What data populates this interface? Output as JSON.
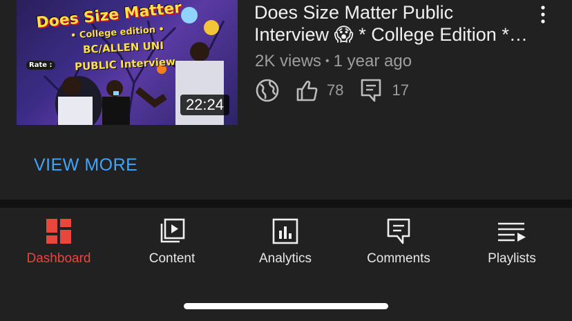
{
  "video": {
    "thumbnail_text": {
      "headline": "Does Size Matter",
      "subline": "• College edition •",
      "school": "BC/ALLEN UNI",
      "interview": "PUBLIC Interview",
      "rate": "Rate :"
    },
    "duration": "22:24",
    "title": "Does Size Matter Public Interview 😱 * College Edition * BC/ALLEN UNI",
    "views": "2K views",
    "age": "1 year ago",
    "visibility_icon": "globe-icon",
    "likes": "78",
    "comments": "17",
    "more_icon": "kebab-icon"
  },
  "view_more_label": "VIEW MORE",
  "tabs": [
    {
      "label": "Dashboard",
      "icon": "dashboard-icon",
      "active": true
    },
    {
      "label": "Content",
      "icon": "content-icon",
      "active": false
    },
    {
      "label": "Analytics",
      "icon": "analytics-icon",
      "active": false
    },
    {
      "label": "Comments",
      "icon": "comments-icon",
      "active": false
    },
    {
      "label": "Playlists",
      "icon": "playlists-icon",
      "active": false
    }
  ],
  "colors": {
    "background": "#212121",
    "accent_link": "#3ea6ff",
    "active_tab": "#e7473c",
    "secondary_text": "#9e9e9e"
  }
}
